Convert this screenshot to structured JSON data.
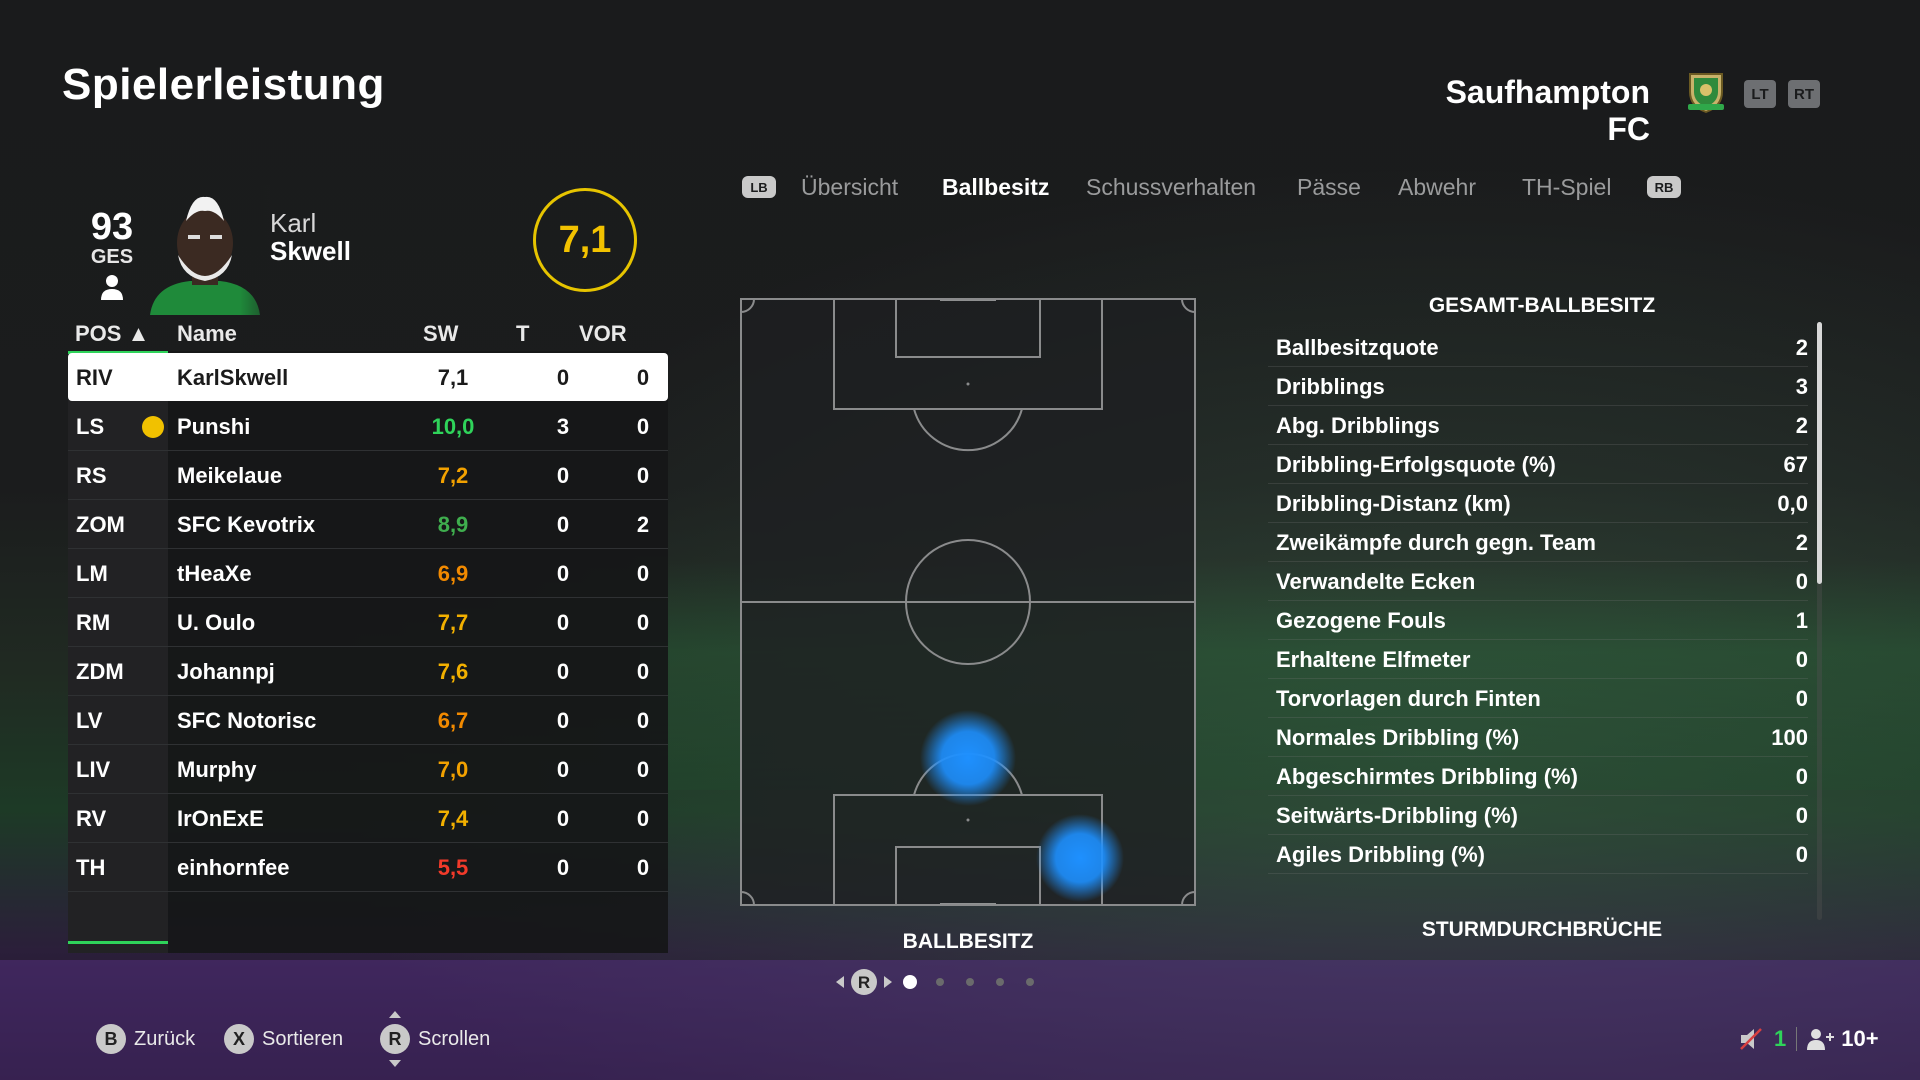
{
  "page_title": "Spielerleistung",
  "club": {
    "name": "Saufhampton FC",
    "lt_label": "LT",
    "rt_label": "RT"
  },
  "player": {
    "overall": "93",
    "overall_label": "GES",
    "first_name": "Karl",
    "last_name": "Skwell",
    "rating": "7,1"
  },
  "table": {
    "headers": {
      "pos": "POS ▲",
      "name": "Name",
      "sw": "SW",
      "t": "T",
      "vor": "VOR"
    },
    "rows": [
      {
        "pos": "RIV",
        "name": "KarlSkwell",
        "sw": "7,1",
        "t": "0",
        "vor": "0",
        "sw_color": "#1b1b1b",
        "selected": true
      },
      {
        "pos": "LS",
        "name": "Punshi",
        "sw": "10,0",
        "t": "3",
        "vor": "0",
        "sw_color": "#2fd35a",
        "ball_icon": true
      },
      {
        "pos": "RS",
        "name": "Meikelaue",
        "sw": "7,2",
        "t": "0",
        "vor": "0",
        "sw_color": "#f2a100"
      },
      {
        "pos": "ZOM",
        "name": "SFC Kevotrix",
        "sw": "8,9",
        "t": "0",
        "vor": "2",
        "sw_color": "#3fae4e"
      },
      {
        "pos": "LM",
        "name": "tHeaXe",
        "sw": "6,9",
        "t": "0",
        "vor": "0",
        "sw_color": "#f28a00"
      },
      {
        "pos": "RM",
        "name": "U. Oulo",
        "sw": "7,7",
        "t": "0",
        "vor": "0",
        "sw_color": "#f2b000"
      },
      {
        "pos": "ZDM",
        "name": "Johannpj",
        "sw": "7,6",
        "t": "0",
        "vor": "0",
        "sw_color": "#f2b000"
      },
      {
        "pos": "LV",
        "name": "SFC Notorisc",
        "sw": "6,7",
        "t": "0",
        "vor": "0",
        "sw_color": "#f28a00"
      },
      {
        "pos": "LIV",
        "name": "Murphy",
        "sw": "7,0",
        "t": "0",
        "vor": "0",
        "sw_color": "#f2a100"
      },
      {
        "pos": "RV",
        "name": "IrOnExE",
        "sw": "7,4",
        "t": "0",
        "vor": "0",
        "sw_color": "#f2b000"
      },
      {
        "pos": "TH",
        "name": "einhornfee",
        "sw": "5,5",
        "t": "0",
        "vor": "0",
        "sw_color": "#f23a2a"
      }
    ]
  },
  "tabs": {
    "lb": "LB",
    "rb": "RB",
    "items": [
      "Übersicht",
      "Ballbesitz",
      "Schussverhalten",
      "Pässe",
      "Abwehr",
      "TH-Spiel"
    ],
    "active": "Ballbesitz"
  },
  "pitch": {
    "label": "BALLBESITZ",
    "heat_color": "#1e90ff",
    "pager_button": "R"
  },
  "stats": {
    "title": "GESAMT-BALLBESITZ",
    "rows": [
      {
        "label": "Ballbesitzquote",
        "value": "2"
      },
      {
        "label": "Dribblings",
        "value": "3"
      },
      {
        "label": "Abg. Dribblings",
        "value": "2"
      },
      {
        "label": "Dribbling-Erfolgsquote (%)",
        "value": "67"
      },
      {
        "label": "Dribbling-Distanz (km)",
        "value": "0,0"
      },
      {
        "label": "Zweikämpfe durch gegn. Team",
        "value": "2"
      },
      {
        "label": "Verwandelte Ecken",
        "value": "0"
      },
      {
        "label": "Gezogene Fouls",
        "value": "1"
      },
      {
        "label": "Erhaltene Elfmeter",
        "value": "0"
      },
      {
        "label": "Torvorlagen durch Finten",
        "value": "0"
      },
      {
        "label": "Normales Dribbling (%)",
        "value": "100"
      },
      {
        "label": "Abgeschirmtes Dribbling (%)",
        "value": "0"
      },
      {
        "label": "Seitwärts-Dribbling (%)",
        "value": "0"
      },
      {
        "label": "Agiles Dribbling (%)",
        "value": "0"
      }
    ],
    "next_title": "STURMDURCHBRÜCHE"
  },
  "footer": {
    "back": {
      "glyph": "B",
      "label": "Zurück"
    },
    "sort": {
      "glyph": "X",
      "label": "Sortieren"
    },
    "scroll": {
      "glyph": "R",
      "label": "Scrollen"
    },
    "mic_count": "1",
    "party_count": "10+"
  },
  "colors": {
    "accent_green": "#2fd35a",
    "rating_ring": "#e6c400"
  }
}
